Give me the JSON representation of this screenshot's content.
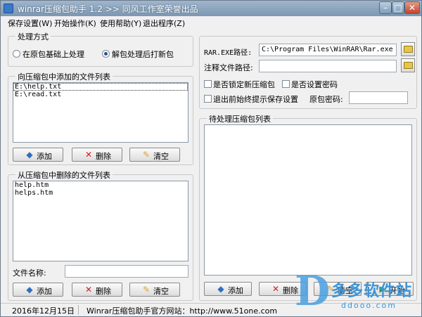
{
  "window": {
    "title": "winrar压缩包助手 1.2  >> 同风工作室荣誉出品",
    "minimize": "–",
    "maximize": "□",
    "close": "✕"
  },
  "menu": [
    "保存设置(W)",
    "开始操作(K)",
    "使用帮助(Y)",
    "退出程序(Z)"
  ],
  "processing": {
    "title": "处理方式",
    "option_original": "在原包基础上处理",
    "option_unpack": "解包处理后打新包",
    "selected": "option_unpack"
  },
  "add_list": {
    "title": "向压缩包中添加的文件列表",
    "items": [
      "E:\\help.txt",
      "E:\\read.txt"
    ],
    "selected_index": 0
  },
  "delete_list": {
    "title": "从压缩包中删除的文件列表",
    "items": [
      "help.htm",
      "helps.htm"
    ]
  },
  "buttons": {
    "add": "添加",
    "delete": "删除",
    "clear": "清空"
  },
  "file_name": {
    "label": "文件名称:",
    "value": ""
  },
  "settings": {
    "rar_path_label": "RAR.EXE路径:",
    "rar_path_value": "C:\\Program Files\\WinRAR\\Rar.exe",
    "comment_path_label": "注释文件路径:",
    "comment_path_value": "",
    "lock_new": "是否锁定新压缩包",
    "set_password": "是否设置密码",
    "prompt_save": "退出前始终提示保存设置",
    "orig_password_label": "原包密码:",
    "orig_password_value": ""
  },
  "pending": {
    "title": "待处理压缩包列表",
    "items": [],
    "add": "添加",
    "delete": "删除",
    "clear": "清空",
    "start": "开始"
  },
  "status": {
    "date": "2016年12月15日",
    "site": "Winrar压缩包助手官方网站：http://www.51one.com"
  },
  "watermark": {
    "text": "多多软件站",
    "url": "ddooo.com"
  }
}
